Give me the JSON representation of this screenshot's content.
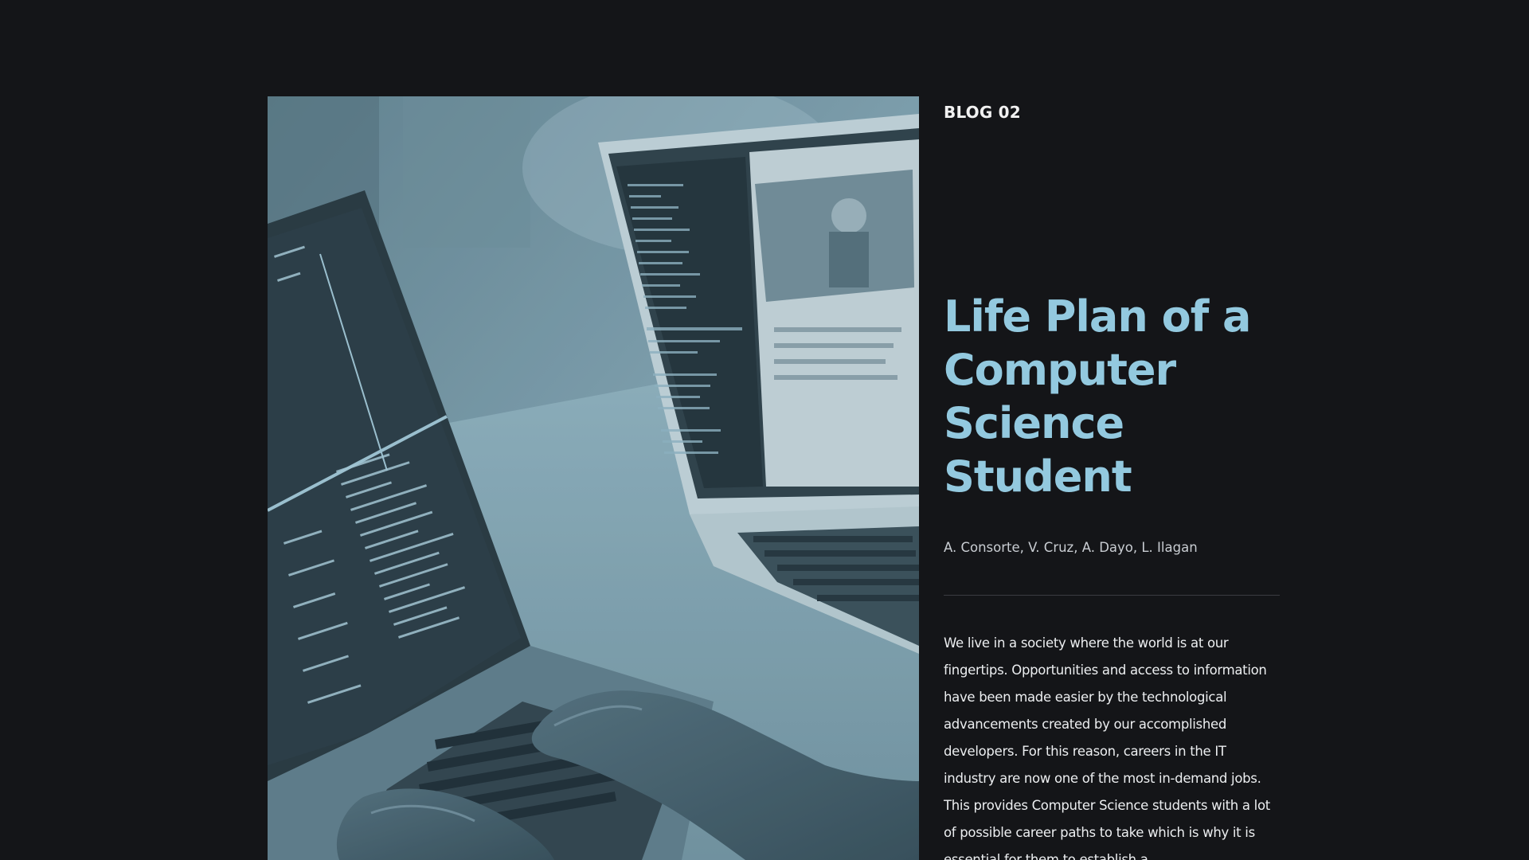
{
  "article": {
    "kicker": "BLOG 02",
    "title": "Life Plan of a Computer Science Student",
    "authors": "A. Consorte, V. Cruz, A. Dayo, L. Ilagan",
    "body": "We live in a society where the world is at our fingertips. Opportunities and access to information have been made easier by the technological advancements created by our accomplished developers. For this reason, careers in the IT industry are now one of the most in-demand jobs. This provides Computer Science students with a lot of possible career paths to take which is why it is essential for them to establish a"
  },
  "colors": {
    "background": "#141518",
    "title": "#93c9df",
    "image_tint": "#7fa4b4"
  },
  "icons": {
    "hero": "laptops-coding-photo"
  }
}
